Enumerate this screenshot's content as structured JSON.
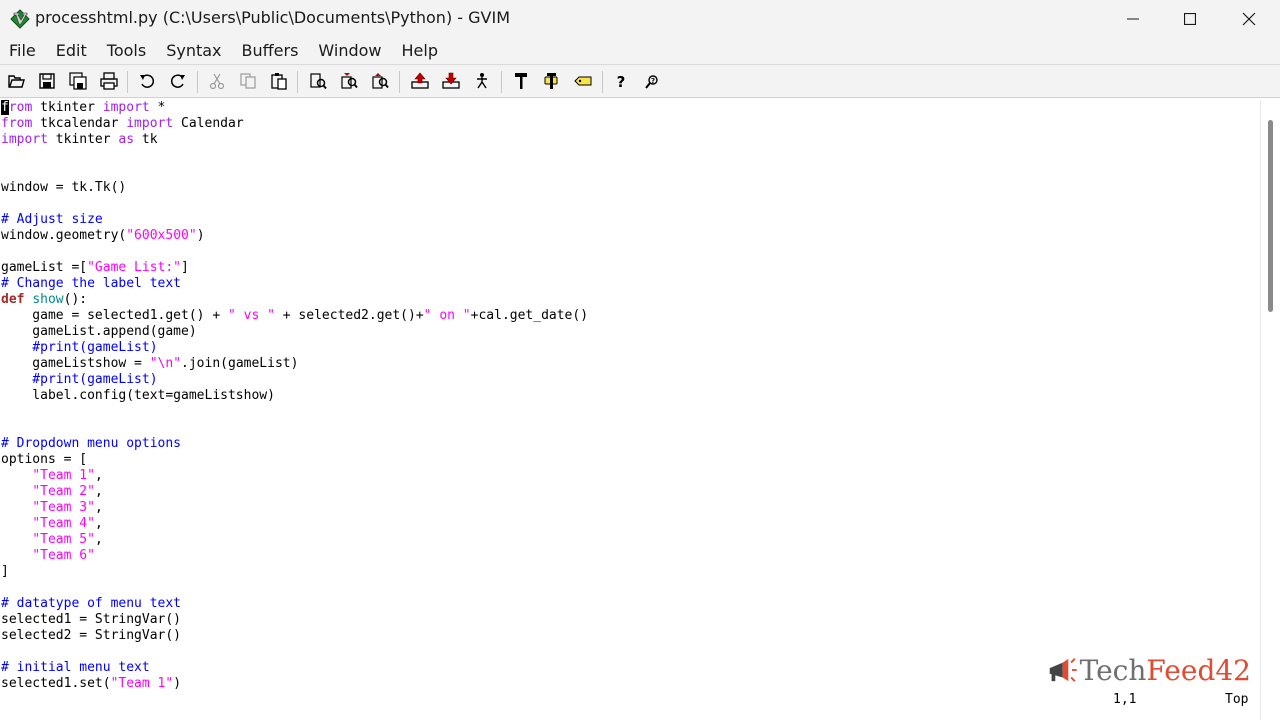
{
  "window": {
    "title": "processhtml.py (C:\\Users\\Public\\Documents\\Python) - GVIM",
    "icon": "gvim-icon"
  },
  "window_controls": [
    "minimize-icon",
    "maximize-icon",
    "close-icon"
  ],
  "menubar": {
    "items": [
      "File",
      "Edit",
      "Tools",
      "Syntax",
      "Buffers",
      "Window",
      "Help"
    ]
  },
  "toolbar": {
    "buttons": [
      "open-icon",
      "save-icon",
      "save-all-icon",
      "print-icon",
      "undo-icon",
      "redo-icon",
      "cut-icon",
      "copy-icon",
      "paste-icon",
      "find-replace-icon",
      "find-next-icon",
      "find-prev-icon",
      "load-session-icon",
      "save-session-icon",
      "run-script-icon",
      "make-icon",
      "build-tags-icon",
      "jump-tag-icon",
      "help-icon",
      "find-help-icon"
    ]
  },
  "editor": {
    "lines": [
      [
        {
          "t": "f",
          "c": "cursor"
        },
        {
          "t": "rom",
          "c": "kw-purple"
        },
        {
          "t": " tkinter "
        },
        {
          "t": "import",
          "c": "kw-purple"
        },
        {
          "t": " *"
        }
      ],
      [
        {
          "t": "from",
          "c": "kw-purple"
        },
        {
          "t": " tkcalendar "
        },
        {
          "t": "import",
          "c": "kw-purple"
        },
        {
          "t": " Calendar"
        }
      ],
      [
        {
          "t": "import",
          "c": "kw-purple"
        },
        {
          "t": " tkinter "
        },
        {
          "t": "as",
          "c": "kw-purple"
        },
        {
          "t": " tk"
        }
      ],
      [],
      [],
      [
        {
          "t": "window = tk.Tk()"
        }
      ],
      [],
      [
        {
          "t": "# Adjust size",
          "c": "cmt"
        }
      ],
      [
        {
          "t": "window.geometry("
        },
        {
          "t": "\"600x500\"",
          "c": "str"
        },
        {
          "t": ")"
        }
      ],
      [],
      [
        {
          "t": "gameList =["
        },
        {
          "t": "\"Game List:\"",
          "c": "str"
        },
        {
          "t": "]"
        }
      ],
      [
        {
          "t": "# Change the label text",
          "c": "cmt"
        }
      ],
      [
        {
          "t": "def",
          "c": "kw-brown"
        },
        {
          "t": " "
        },
        {
          "t": "show",
          "c": "fn-cyan"
        },
        {
          "t": "():"
        }
      ],
      [
        {
          "t": "    game = selected1.get() + "
        },
        {
          "t": "\" vs \"",
          "c": "str"
        },
        {
          "t": " + selected2.get()+"
        },
        {
          "t": "\" on \"",
          "c": "str"
        },
        {
          "t": "+cal.get_date()"
        }
      ],
      [
        {
          "t": "    gameList.append(game)"
        }
      ],
      [
        {
          "t": "    #print(gameList)",
          "c": "cmt"
        }
      ],
      [
        {
          "t": "    gameListshow = "
        },
        {
          "t": "\"\\n\"",
          "c": "str"
        },
        {
          "t": ".join(gameList)"
        }
      ],
      [
        {
          "t": "    #print(gameList)",
          "c": "cmt"
        }
      ],
      [
        {
          "t": "    label.config(text=gameListshow)"
        }
      ],
      [],
      [],
      [
        {
          "t": "# Dropdown menu options",
          "c": "cmt"
        }
      ],
      [
        {
          "t": "options = ["
        }
      ],
      [
        {
          "t": "    "
        },
        {
          "t": "\"Team 1\"",
          "c": "str"
        },
        {
          "t": ","
        }
      ],
      [
        {
          "t": "    "
        },
        {
          "t": "\"Team 2\"",
          "c": "str"
        },
        {
          "t": ","
        }
      ],
      [
        {
          "t": "    "
        },
        {
          "t": "\"Team 3\"",
          "c": "str"
        },
        {
          "t": ","
        }
      ],
      [
        {
          "t": "    "
        },
        {
          "t": "\"Team 4\"",
          "c": "str"
        },
        {
          "t": ","
        }
      ],
      [
        {
          "t": "    "
        },
        {
          "t": "\"Team 5\"",
          "c": "str"
        },
        {
          "t": ","
        }
      ],
      [
        {
          "t": "    "
        },
        {
          "t": "\"Team 6\"",
          "c": "str"
        }
      ],
      [
        {
          "t": "]"
        }
      ],
      [],
      [
        {
          "t": "# datatype of menu text",
          "c": "cmt"
        }
      ],
      [
        {
          "t": "selected1 = StringVar()"
        }
      ],
      [
        {
          "t": "selected2 = StringVar()"
        }
      ],
      [],
      [
        {
          "t": "# initial menu text",
          "c": "cmt"
        }
      ],
      [
        {
          "t": "selected1.set("
        },
        {
          "t": "\"Team 1\"",
          "c": "str"
        },
        {
          "t": ")"
        }
      ]
    ]
  },
  "statusline": {
    "position": "1,1",
    "scroll": "Top"
  },
  "watermark": {
    "text_tech": "Tech",
    "text_feed": "Feed42",
    "icon": "megaphone-logo-icon"
  }
}
